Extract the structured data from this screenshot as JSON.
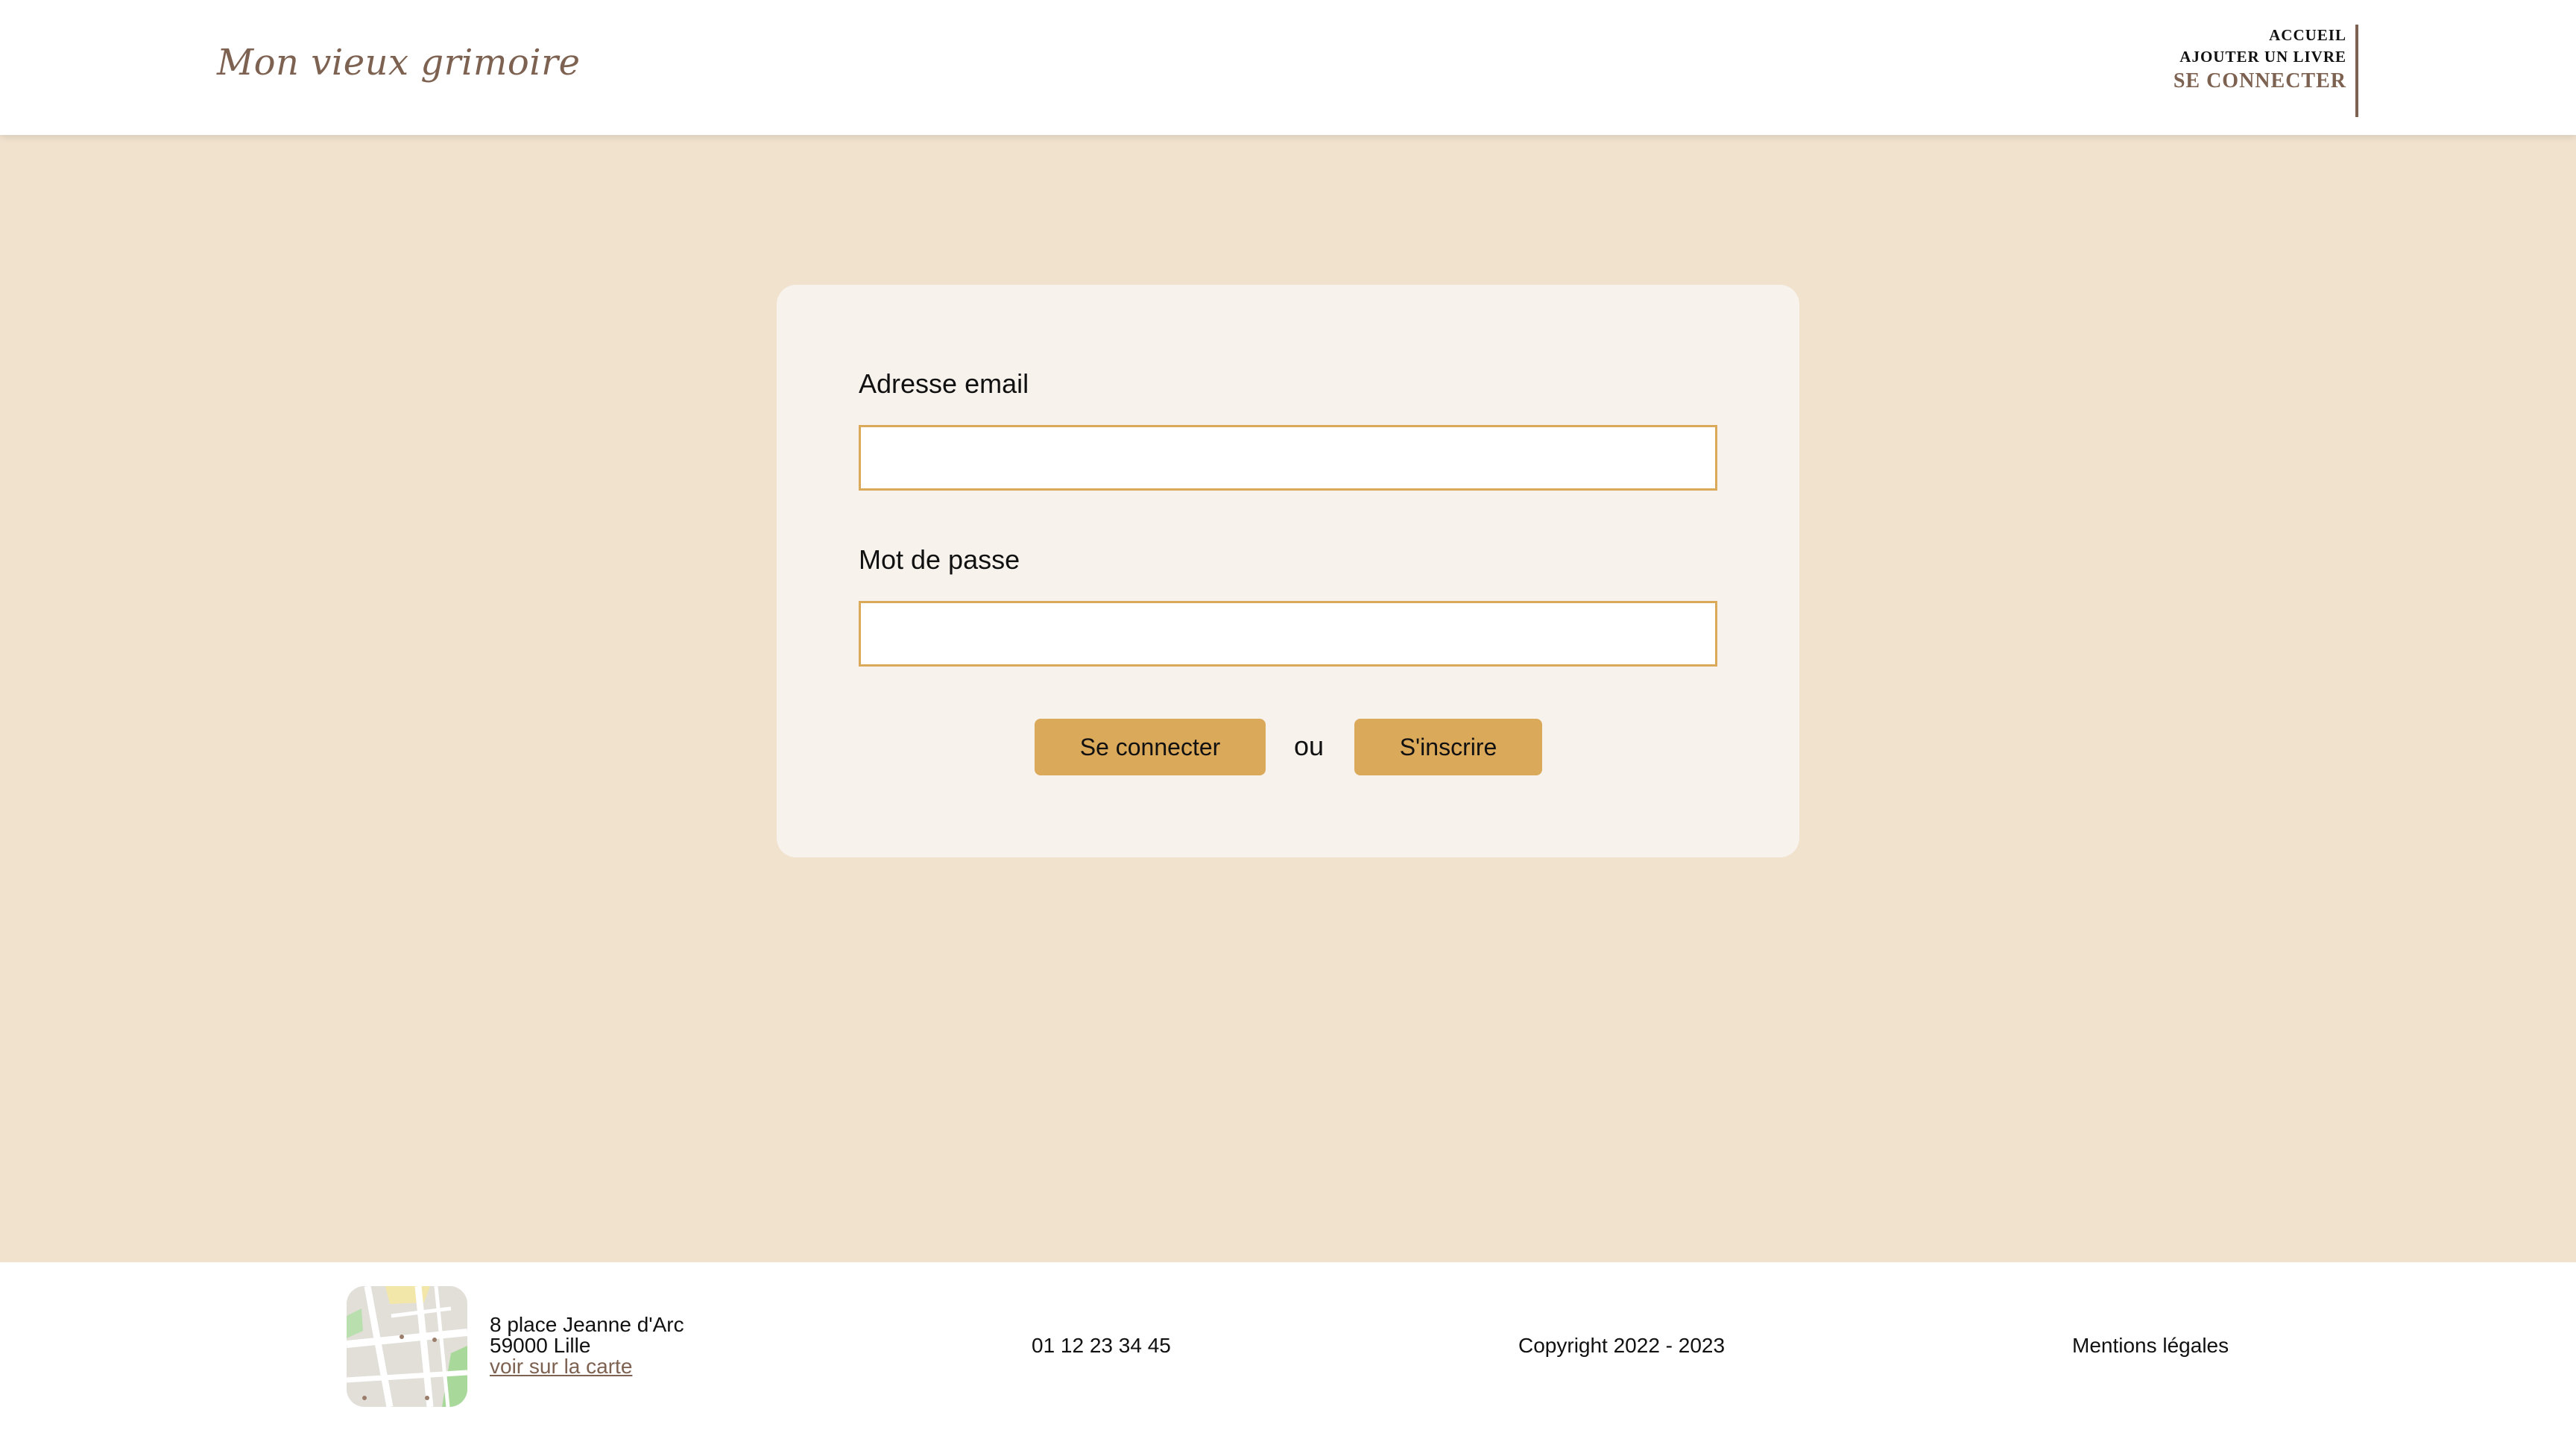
{
  "header": {
    "logo": "Mon vieux grimoire",
    "nav": [
      {
        "label": "ACCUEIL",
        "active": false
      },
      {
        "label": "AJOUTER UN LIVRE",
        "active": false
      },
      {
        "label": "SE CONNECTER",
        "active": true
      }
    ]
  },
  "form": {
    "email_label": "Adresse email",
    "email_value": "",
    "password_label": "Mot de passe",
    "password_value": "",
    "login_button": "Se connecter",
    "separator": "ou",
    "signup_button": "S'inscrire"
  },
  "footer": {
    "address_line1": "8 place Jeanne d'Arc",
    "address_line2": "59000 Lille",
    "map_link": "voir sur la carte",
    "phone": "01 12 23 34 45",
    "copyright": "Copyright 2022 - 2023",
    "legal": "Mentions légales"
  },
  "colors": {
    "page_background": "#f0e2cd",
    "card_background": "#f7f2ec",
    "accent": "#dba95a",
    "brand": "#7d6251"
  }
}
